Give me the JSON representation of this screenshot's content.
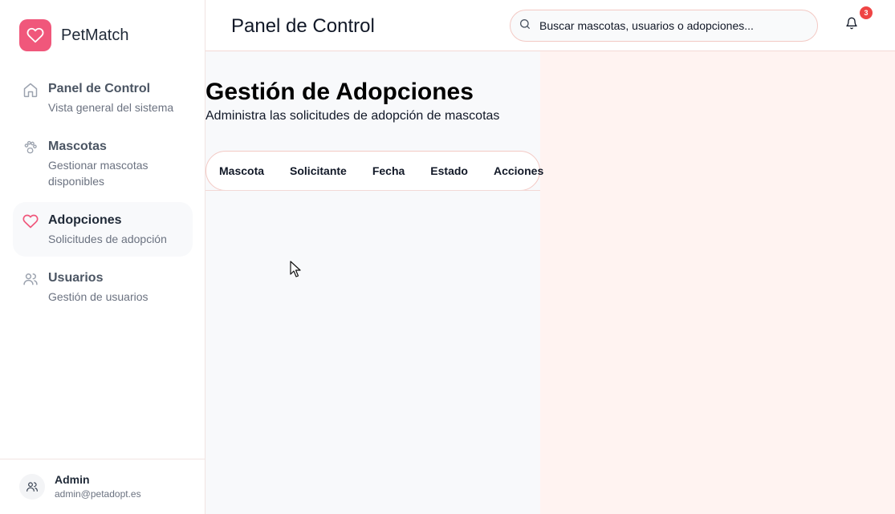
{
  "brand": {
    "name": "PetMatch",
    "accent": "#f0577b"
  },
  "sidebar": {
    "items": [
      {
        "label": "Panel de Control",
        "desc": "Vista general del sistema",
        "icon": "home-icon"
      },
      {
        "label": "Mascotas",
        "desc": "Gestionar mascotas disponibles",
        "icon": "paw-icon"
      },
      {
        "label": "Adopciones",
        "desc": "Solicitudes de adopción",
        "icon": "heart-icon",
        "active": true
      },
      {
        "label": "Usuarios",
        "desc": "Gestión de usuarios",
        "icon": "users-icon"
      }
    ],
    "user": {
      "name": "Admin",
      "email": "admin@petadopt.es"
    }
  },
  "header": {
    "title": "Panel de Control",
    "search_placeholder": "Buscar mascotas, usuarios o adopciones...",
    "notifications_count": "3"
  },
  "main": {
    "title": "Gestión de Adopciones",
    "subtitle": "Administra las solicitudes de adopción de mascotas",
    "table_headers": [
      "Mascota",
      "Solicitante",
      "Fecha",
      "Estado",
      "Acciones"
    ]
  }
}
